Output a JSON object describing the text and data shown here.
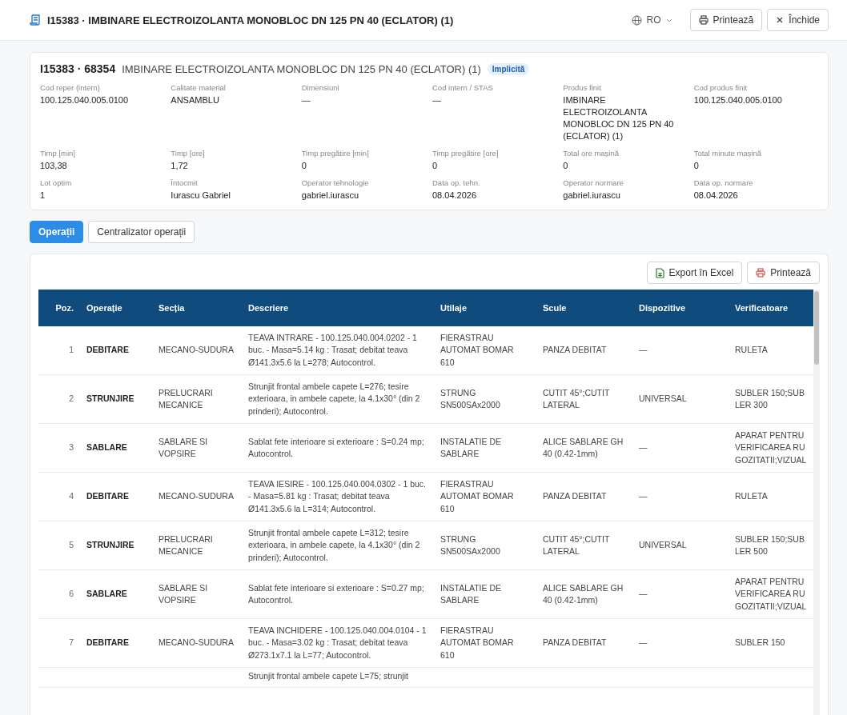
{
  "header": {
    "title": "I15383 · IMBINARE ELECTROIZOLANTA MONOBLOC DN 125 PN 40 (ECLATOR) (1)",
    "language": "RO",
    "buttons": [
      {
        "kind": "print",
        "label": "Printează"
      },
      {
        "kind": "close",
        "label": "Închide"
      }
    ]
  },
  "summary": {
    "code": "I15383 · 68354",
    "name": "IMBINARE ELECTROIZOLANTA MONOBLOC DN 125 PN 40 (ECLATOR) (1)",
    "badge": "Implicită",
    "fields": [
      {
        "label": "Cod reper (intern)",
        "value": "100.125.040.005.0100"
      },
      {
        "label": "Calitate material",
        "value": "ANSAMBLU"
      },
      {
        "label": "Dimensiuni",
        "value": "—"
      },
      {
        "label": "Cod intern / STAS",
        "value": "—"
      },
      {
        "label": "Produs finit",
        "value": "IMBINARE ELECTROIZOLANTA MONOBLOC DN 125 PN 40 (ECLATOR) (1)"
      },
      {
        "label": "Cod produs finit",
        "value": "100.125.040.005.0100"
      },
      {
        "label": "Timp [min]",
        "value": "103,38"
      },
      {
        "label": "Timp [ore]",
        "value": "1,72"
      },
      {
        "label": "Timp pregătire [min]",
        "value": "0"
      },
      {
        "label": "Timp pregătire [ore]",
        "value": "0"
      },
      {
        "label": "Total ore mașină",
        "value": "0"
      },
      {
        "label": "Total minute mașină",
        "value": "0"
      },
      {
        "label": "Lot optim",
        "value": "1"
      },
      {
        "label": "Întocmit",
        "value": "Iurascu Gabriel"
      },
      {
        "label": "Operator tehnologie",
        "value": "gabriel.iurascu"
      },
      {
        "label": "Data op. tehn.",
        "value": "08.04.2026"
      },
      {
        "label": "Operator normare",
        "value": "gabriel.iurascu"
      },
      {
        "label": "Data op. normare",
        "value": "08.04.2026"
      }
    ]
  },
  "tabs": [
    {
      "label": "Operații",
      "selected": true
    },
    {
      "label": "Centralizator operații",
      "selected": false
    }
  ],
  "toolbar": [
    {
      "kind": "excel",
      "label": "Export în Excel"
    },
    {
      "kind": "print",
      "label": "Printează"
    }
  ],
  "table": {
    "columns": [
      "Poz.",
      "Operație",
      "Secția",
      "Descriere",
      "Utilaje",
      "Scule",
      "Dispozitive",
      "Verificatoare"
    ],
    "rows": [
      [
        "1",
        "DEBITARE",
        "MECANO-SUDURA",
        "TEAVA INTRARE - 100.125.040.004.0202 - 1 buc. - Masa=5.14 kg : Trasat; debitat teava Ø141.3x5.6 la L=278; Autocontrol.",
        "FIERASTRAU AUTOMAT BOMAR 610",
        "PANZA DEBITAT",
        "—",
        "RULETA"
      ],
      [
        "2",
        "STRUNJIRE",
        "PRELUCRARI MECANICE",
        "Strunjit frontal ambele capete L=276; tesire exterioara, in ambele capete, la 4.1x30° (din 2 prinderi); Autocontrol.",
        "STRUNG SN500SAx2000",
        "CUTIT 45°;CUTIT LATERAL",
        "UNIVERSAL",
        "SUBLER 150;SUBLER 300"
      ],
      [
        "3",
        "SABLARE",
        "SABLARE SI VOPSIRE",
        "Sablat fete interioare si exterioare : S=0.24 mp; Autocontrol.",
        "INSTALATIE DE SABLARE",
        "ALICE SABLARE GH 40 (0.42-1mm)",
        "—",
        "APARAT PENTRU VERIFICAREA RUGOZITATII;VIZUAL"
      ],
      [
        "4",
        "DEBITARE",
        "MECANO-SUDURA",
        "TEAVA IESIRE - 100.125.040.004.0302 - 1 buc. - Masa=5.81 kg : Trasat; debitat teava Ø141.3x5.6 la L=314; Autocontrol.",
        "FIERASTRAU AUTOMAT BOMAR 610",
        "PANZA DEBITAT",
        "—",
        "RULETA"
      ],
      [
        "5",
        "STRUNJIRE",
        "PRELUCRARI MECANICE",
        "Strunjit frontal ambele capete L=312; tesire exterioara, in ambele capete, la 4.1x30° (din 2 prinderi); Autocontrol.",
        "STRUNG SN500SAx2000",
        "CUTIT 45°;CUTIT LATERAL",
        "UNIVERSAL",
        "SUBLER 150;SUBLER 500"
      ],
      [
        "6",
        "SABLARE",
        "SABLARE SI VOPSIRE",
        "Sablat fete interioare si exterioare : S=0.27 mp; Autocontrol.",
        "INSTALATIE DE SABLARE",
        "ALICE SABLARE GH 40 (0.42-1mm)",
        "—",
        "APARAT PENTRU VERIFICAREA RUGOZITATII;VIZUAL"
      ],
      [
        "7",
        "DEBITARE",
        "MECANO-SUDURA",
        "TEAVA INCHIDERE - 100.125.040.004.0104 - 1 buc. - Masa=3.02 kg : Trasat; debitat teava Ø273.1x7.1 la L=77; Autocontrol.",
        "FIERASTRAU AUTOMAT BOMAR 610",
        "PANZA DEBITAT",
        "—",
        "SUBLER 150"
      ],
      [
        "",
        "",
        "",
        "Strunjit frontal ambele capete L=75; strunjit",
        "",
        "",
        "",
        ""
      ]
    ]
  }
}
